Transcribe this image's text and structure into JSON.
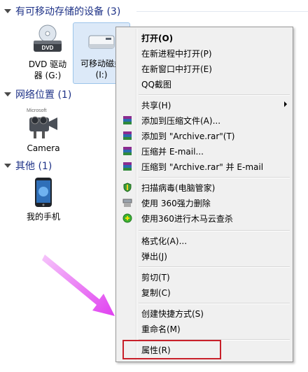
{
  "groups": {
    "removable": {
      "title": "有可移动存储的设备 (3)"
    },
    "network": {
      "title": "网络位置 (1)"
    },
    "other": {
      "title": "其他 (1)"
    }
  },
  "devices": {
    "dvd": {
      "label": "DVD 驱动\n器 (G:)",
      "badge": "DVD"
    },
    "removable_disk": {
      "label": "可移动磁盘\n(I:)"
    },
    "camera": {
      "label": "Camera"
    },
    "phone": {
      "label": "我的手机"
    }
  },
  "context_menu": {
    "open": "打开(O)",
    "open_new_process": "在新进程中打开(P)",
    "open_new_window": "在新窗口中打开(E)",
    "qq_screenshot": "QQ截图",
    "share": "共享(H)",
    "add_to_archive": "添加到压缩文件(A)...",
    "add_to_archive_rar": "添加到 \"Archive.rar\"(T)",
    "compress_email": "压缩并 E-mail...",
    "compress_rar_email": "压缩到 \"Archive.rar\" 并 E-mail",
    "scan_virus": "扫描病毒(电脑管家)",
    "force_delete_360": "使用 360强力删除",
    "trojan_scan_360": "使用360进行木马云查杀",
    "format": "格式化(A)...",
    "eject": "弹出(J)",
    "cut": "剪切(T)",
    "copy": "复制(C)",
    "create_shortcut": "创建快捷方式(S)",
    "rename": "重命名(M)",
    "properties": "属性(R)"
  },
  "colors": {
    "highlight_box": "#c8202a",
    "pointer_arrow": "#e040f0"
  }
}
